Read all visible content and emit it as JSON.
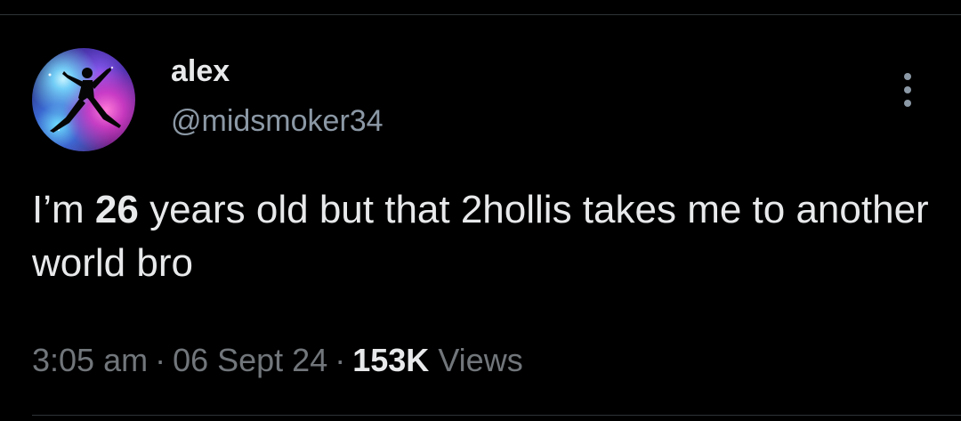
{
  "user": {
    "name": "alex",
    "handle": "@midsmoker34"
  },
  "tweet": {
    "text_before": "I’m ",
    "highlight": "26",
    "text_after": " years old but that 2hollis takes me to another world bro"
  },
  "meta": {
    "time": "3:05 am",
    "date": "06 Sept 24",
    "views_count": "153K",
    "views_label": "Views",
    "separator": "·"
  },
  "icons": {
    "more": "more-vertical-icon",
    "avatar": "jumpman-galaxy-avatar"
  },
  "colors": {
    "background": "#000000",
    "primary_text": "#e7e9ea",
    "secondary_text": "#71767b"
  }
}
